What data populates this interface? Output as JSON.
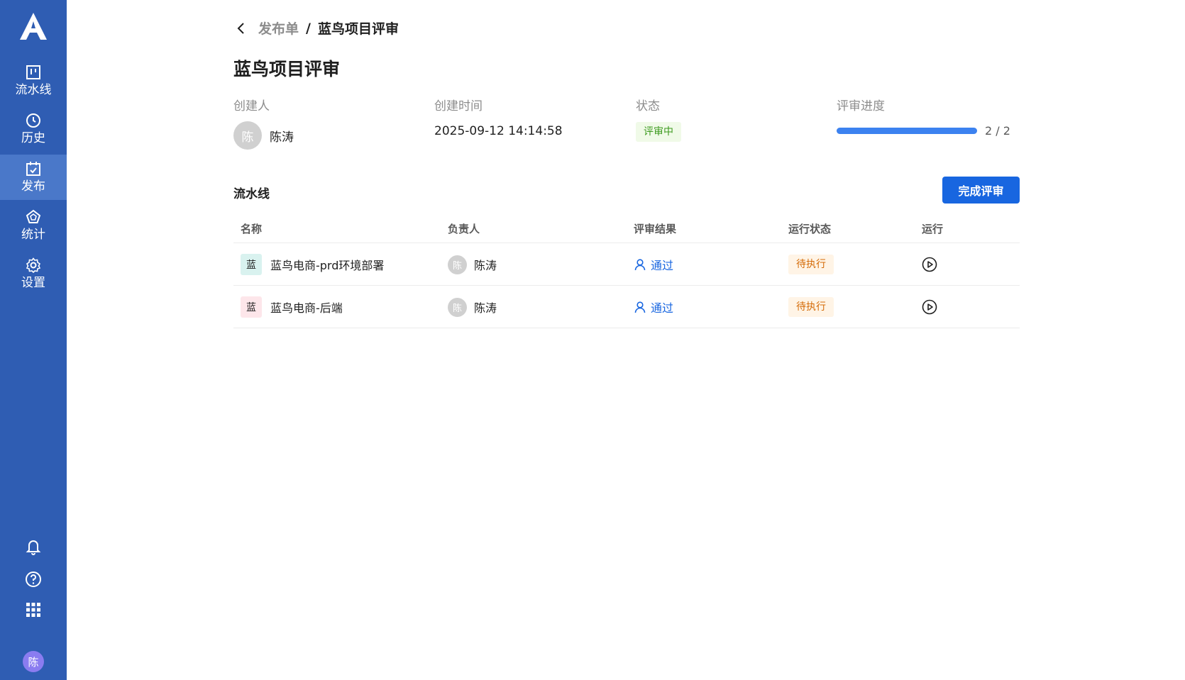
{
  "sidebar": {
    "logo": "A",
    "items": [
      {
        "label": "流水线",
        "icon": "pipeline-icon"
      },
      {
        "label": "历史",
        "icon": "clock-icon"
      },
      {
        "label": "发布",
        "icon": "calendar-check-icon",
        "active": true
      },
      {
        "label": "统计",
        "icon": "pentagon-chart-icon"
      },
      {
        "label": "设置",
        "icon": "gear-icon"
      }
    ],
    "bottom_icons": [
      "bell-icon",
      "help-icon",
      "apps-grid-icon"
    ],
    "user_avatar": "陈",
    "colors": {
      "background": "#2f5db3",
      "active": "#4a78c9"
    }
  },
  "breadcrumb": {
    "parent": "发布单",
    "separator": "/",
    "current": "蓝鸟项目评审"
  },
  "page": {
    "title": "蓝鸟项目评审"
  },
  "meta": {
    "creator_label": "创建人",
    "creator_avatar": "陈",
    "creator_name": "陈涛",
    "created_time_label": "创建时间",
    "created_time": "2025-09-12 14:14:58",
    "status_label": "状态",
    "status": "评审中",
    "progress_label": "评审进度",
    "progress_fraction": 1.0,
    "progress_text": "2 / 2"
  },
  "pipelines": {
    "section_title": "流水线",
    "complete_button": "完成评审",
    "columns": [
      "名称",
      "负责人",
      "评审结果",
      "运行状态",
      "运行"
    ],
    "rows": [
      {
        "badge": "蓝",
        "badge_color": "#d9f2ef",
        "name": "蓝鸟电商-prd环境部署",
        "owner_avatar": "陈",
        "owner": "陈涛",
        "review_result": "通过",
        "run_status": "待执行"
      },
      {
        "badge": "蓝",
        "badge_color": "#fde6ea",
        "name": "蓝鸟电商-后端",
        "owner_avatar": "陈",
        "owner": "陈涛",
        "review_result": "通过",
        "run_status": "待执行"
      }
    ]
  }
}
